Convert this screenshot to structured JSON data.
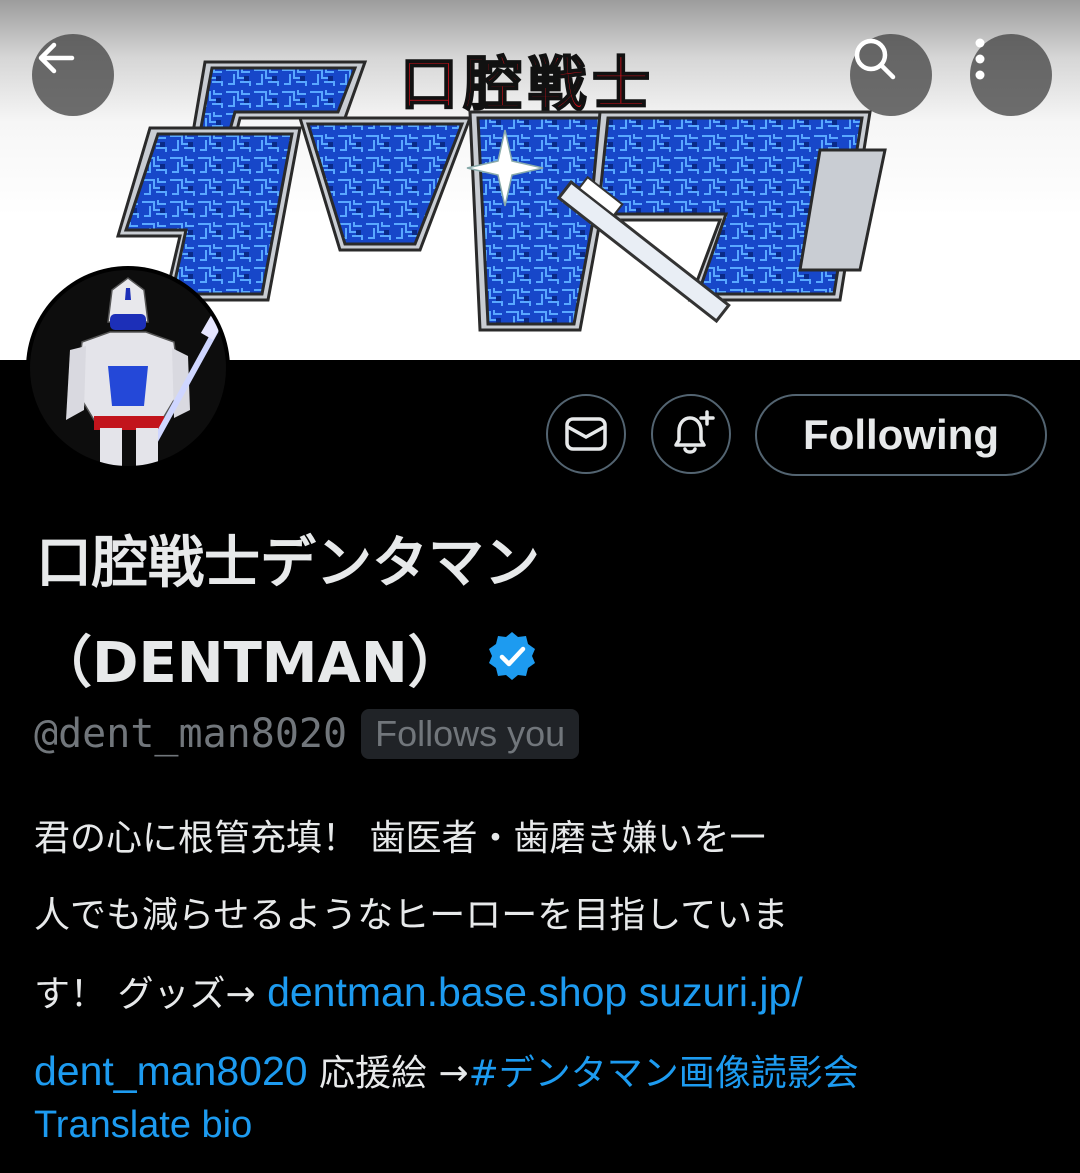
{
  "banner": {
    "logo_title": "口腔戦士",
    "logo_main": "デンタマン"
  },
  "header": {
    "back_icon": "back-arrow-icon",
    "search_icon": "search-icon",
    "more_icon": "more-vertical-icon"
  },
  "actions": {
    "message_icon": "mail-icon",
    "notify_icon": "bell-plus-icon",
    "follow_label": "Following"
  },
  "profile": {
    "name_line1": "口腔戦士デンタマン",
    "name_line2": "（DENTMAN）",
    "verified_icon": "verified-badge-icon",
    "handle": "@dent_man8020",
    "follows_you": "Follows you"
  },
  "bio": {
    "line1": "君の心に根管充填！ 歯医者・歯磨き嫌いを一",
    "line2": "人でも減らせるようなヒーローを目指していま",
    "line3_text": "す！ グッズ→ ",
    "link1": "dentman.base.shop",
    "link2_a": "suzuri.jp/",
    "link2_b": "dent_man8020",
    "line4_text": " 応援絵 →",
    "hashtag": "#デンタマン画像読影会"
  },
  "translate_label": "Translate bio",
  "colors": {
    "background": "#000000",
    "text": "#e7e9ea",
    "muted": "#71767b",
    "link": "#1d9bf0",
    "border": "#536471",
    "logo_blue": "#1a4fd0",
    "logo_red": "#d1101a"
  }
}
